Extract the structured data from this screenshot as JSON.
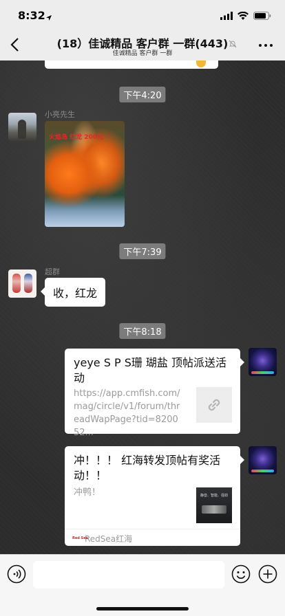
{
  "status_bar": {
    "time": "8:32",
    "icons": [
      "location-arrow-icon",
      "signal-icon",
      "wifi-icon",
      "battery-icon"
    ]
  },
  "nav": {
    "title": "(18）佳诚精品 客户群 一群(443)",
    "subtitle": "佳诚精品 客户群 一群",
    "icons": [
      "back-chevron-icon",
      "mute-icon",
      "more-icon"
    ]
  },
  "chat": {
    "timestamps": [
      "下午4:20",
      "下午7:39",
      "下午8:18"
    ],
    "messages": [
      {
        "sender": "小亮先生",
        "type": "image",
        "caption": "火焰岛 红龙 200元"
      },
      {
        "sender": "超群",
        "type": "text",
        "text": "收，红龙"
      },
      {
        "sender": "self",
        "type": "link",
        "title": "yeye S P S珊 瑚盐 顶帖派送活动",
        "desc": "https://app.cmfish.com/mag/circle/v1/forum/threadWapPage?tid=820052...",
        "thumb_icon": "link-icon"
      },
      {
        "sender": "self",
        "type": "link",
        "title": "冲！！！ 红海转发顶帖有奖活动！！",
        "desc": "冲鸭！",
        "thumb_text": "静音、智能、强劲",
        "source": "RedSea红海",
        "source_logo": "Red Sea"
      }
    ]
  },
  "input_bar": {
    "placeholder": "",
    "icons": [
      "voice-icon",
      "emoji-icon",
      "plus-icon"
    ]
  }
}
